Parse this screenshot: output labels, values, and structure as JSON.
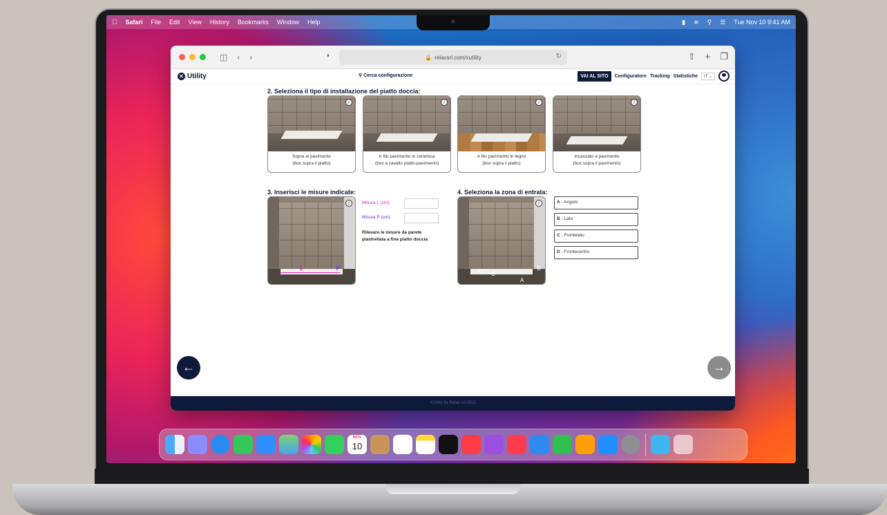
{
  "menubar": {
    "apple": "",
    "app": "Safari",
    "items": [
      "File",
      "Edit",
      "View",
      "History",
      "Bookmarks",
      "Window",
      "Help"
    ],
    "clock": "Tue Nov 10  9:41 AM"
  },
  "browser": {
    "url": "relaxsrl.com/xutility"
  },
  "app": {
    "logo": "Utility",
    "search": "Cerca configurazione",
    "vai_al_sito": "VAI AL SITO",
    "nav": [
      "Configuratore",
      "Tracking",
      "Statistiche"
    ],
    "lang": "IT"
  },
  "section2": {
    "title": "2. Seleziona il tipo di installazione del piatto doccia:",
    "options": [
      {
        "line1": "Sopra al pavimento",
        "line2": "(box sopra il piatto)"
      },
      {
        "line1": "A filo pavimento in ceramica",
        "line2": "(box a cavallo piatto-pavimento)"
      },
      {
        "line1": "A filo pavimento in legno",
        "line2": "(box sopra il piatto)"
      },
      {
        "line1": "Incassato a pavimento",
        "line2": "(box sopra il pavimento)"
      }
    ]
  },
  "section3": {
    "title": "3. Inserisci le misure indicate:",
    "misura_l": "Misura L (cm):",
    "misura_p": "Misura P (cm):",
    "note": "Rilevare le misure da parete piastrellata a fine piatto doccia",
    "label_l": "L",
    "label_p": "P"
  },
  "section4": {
    "title": "4. Seleziona la zona di entrata:",
    "zones": [
      {
        "key": "A",
        "label": " - Angolo"
      },
      {
        "key": "B",
        "label": " - Lato"
      },
      {
        "key": "C",
        "label": " - Frontelato"
      },
      {
        "key": "D",
        "label": " - Frontecentro"
      }
    ],
    "photo_labels": [
      "D",
      "C",
      "A",
      "B"
    ]
  },
  "footer": "XUtility by Relax srl 2022",
  "dock": {
    "icons": [
      "finder-icon",
      "launchpad-icon",
      "safari-icon",
      "messages-icon",
      "mail-icon",
      "maps-icon",
      "photos-icon",
      "facetime-icon",
      "calendar-icon",
      "contacts-icon",
      "reminders-icon",
      "notes-icon",
      "tv-icon",
      "music-icon",
      "podcasts-icon",
      "news-icon",
      "keynote-icon",
      "numbers-icon",
      "pages-icon",
      "appstore-icon",
      "settings-icon",
      "downloads-icon",
      "trash-icon"
    ],
    "calendar_month": "NOV",
    "calendar_day": "10"
  }
}
